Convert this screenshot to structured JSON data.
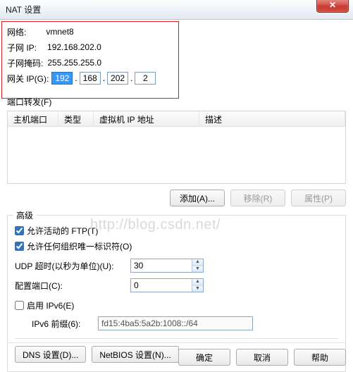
{
  "window": {
    "title": "NAT 设置",
    "close_glyph": "✕"
  },
  "network": {
    "label": "网络:",
    "value": "vmnet8"
  },
  "subnet_ip": {
    "label": "子网 IP:",
    "value": "192.168.202.0"
  },
  "subnet_mask": {
    "label": "子网掩码:",
    "value": "255.255.255.0"
  },
  "gateway": {
    "label": "网关 IP(G):",
    "oct1": "192",
    "oct2": "168",
    "oct3": "202",
    "oct4": "2",
    "dot": "."
  },
  "port_forward": {
    "title": "端口转发(F)",
    "cols": {
      "host_port": "主机端口",
      "type": "类型",
      "vm_ip": "虚拟机 IP 地址",
      "desc": "描述"
    },
    "btn_add": "添加(A)...",
    "btn_remove": "移除(R)",
    "btn_props": "属性(P)"
  },
  "advanced": {
    "title": "高级",
    "chk_ftp": "允许活动的 FTP(T)",
    "chk_org": "允许任何组织唯一标识符(O)",
    "udp_label": "UDP 超时(以秒为单位)(U):",
    "udp_value": "30",
    "cfg_port_label": "配置端口(C):",
    "cfg_port_value": "0",
    "chk_ipv6": "启用 IPv6(E)",
    "ipv6_prefix_label": "IPv6 前缀(6):",
    "ipv6_prefix_value": "fd15:4ba5:5a2b:1008::/64",
    "btn_dns": "DNS 设置(D)...",
    "btn_netbios": "NetBIOS 设置(N)..."
  },
  "footer": {
    "ok": "确定",
    "cancel": "取消",
    "help": "帮助"
  },
  "watermark": "http://blog.csdn.net/"
}
